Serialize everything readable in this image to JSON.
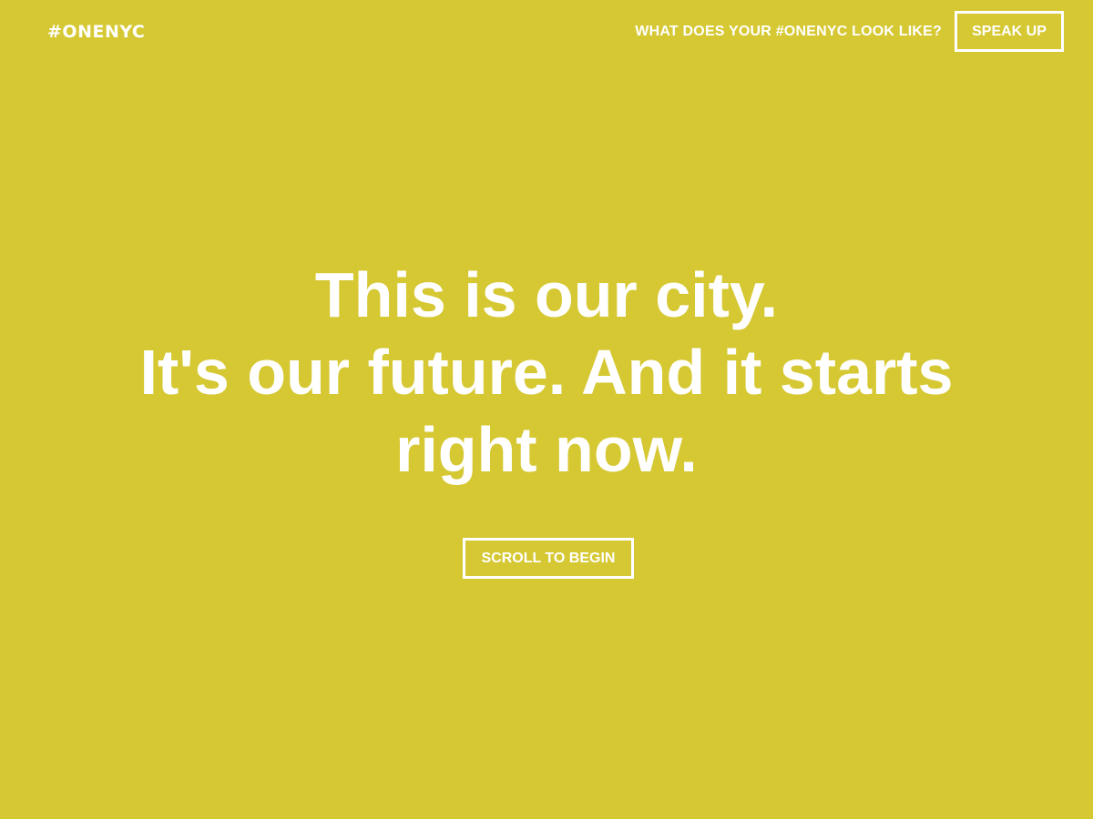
{
  "header": {
    "logo_text": "#ONENYC",
    "question": "WHAT DOES YOUR #ONENYC LOOK LIKE?",
    "speak_up_label": "SPEAK UP"
  },
  "hero": {
    "lines": [
      "This is our city.",
      "It's our future. And it starts",
      "right now."
    ],
    "scroll_label": "SCROLL TO BEGIN"
  },
  "colors": {
    "background": "#d6c833",
    "text": "#ffffff"
  }
}
